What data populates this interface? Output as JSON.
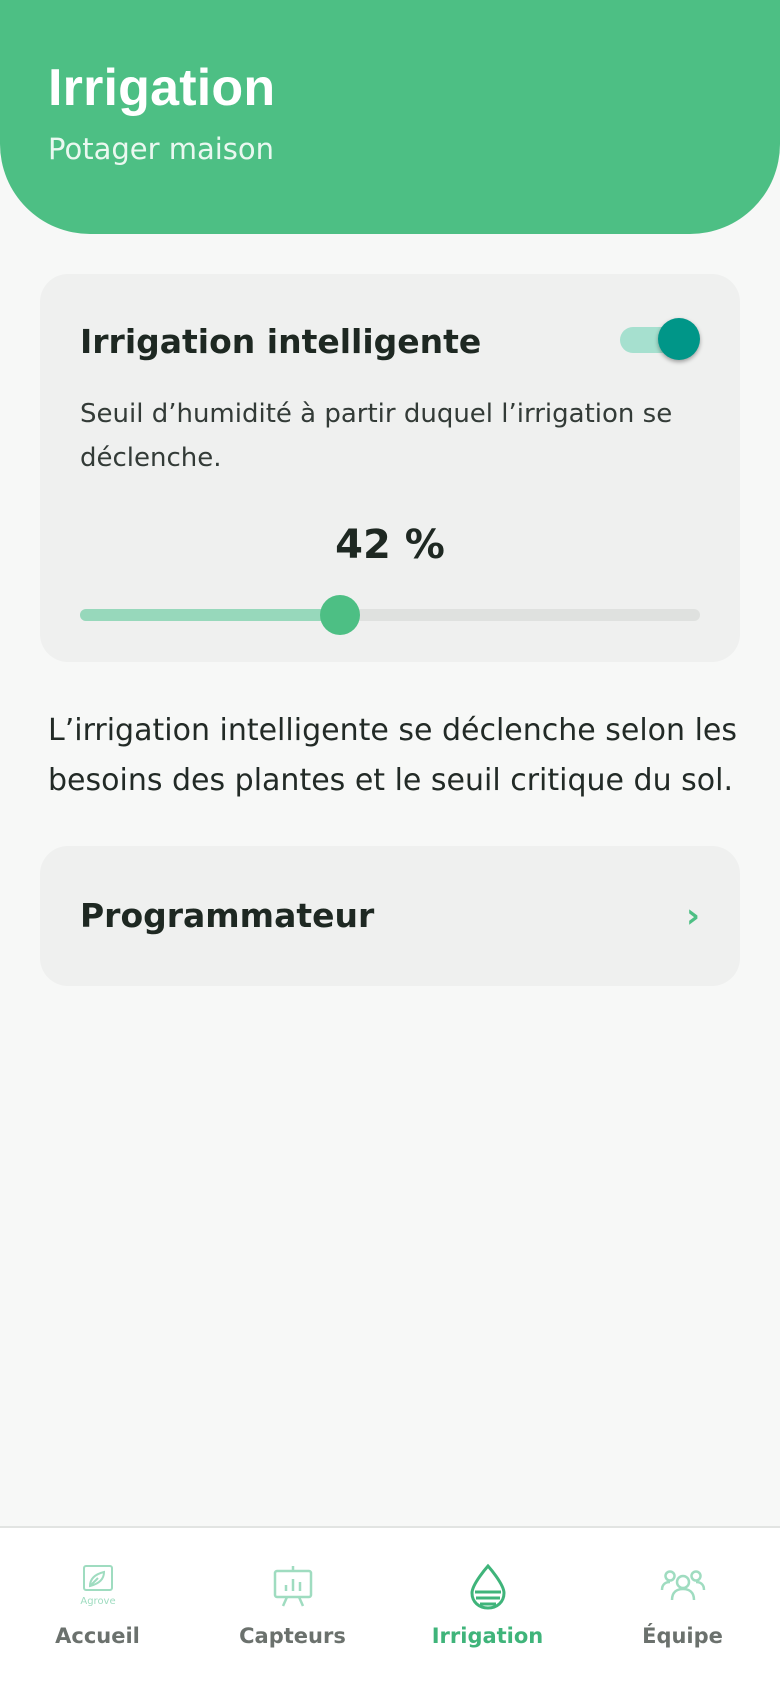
{
  "header": {
    "title": "Irrigation",
    "subtitle": "Potager maison"
  },
  "smart_irrigation": {
    "title": "Irrigation intelligente",
    "enabled": true,
    "description": "Seuil d’humidité à partir duquel l’irrigation se déclenche.",
    "threshold_label": "42 %",
    "threshold_percent": 42
  },
  "info_text": "L’irrigation intelligente se déclenche selon les besoins des plantes et le seuil critique du sol.",
  "programmer": {
    "label": "Programmateur",
    "chevron": "›"
  },
  "bottom_nav": {
    "items": [
      {
        "label": "Accueil",
        "icon": "agrove-logo-icon",
        "logo_text": "Agrove",
        "active": false
      },
      {
        "label": "Capteurs",
        "icon": "chart-board-icon",
        "active": false
      },
      {
        "label": "Irrigation",
        "icon": "water-drop-icon",
        "active": true
      },
      {
        "label": "Équipe",
        "icon": "team-icon",
        "active": false
      }
    ]
  },
  "colors": {
    "primary": "#4dbf84",
    "toggle_on": "#009688",
    "toggle_track": "#a6e0cf",
    "card_bg": "#eff0ef"
  }
}
